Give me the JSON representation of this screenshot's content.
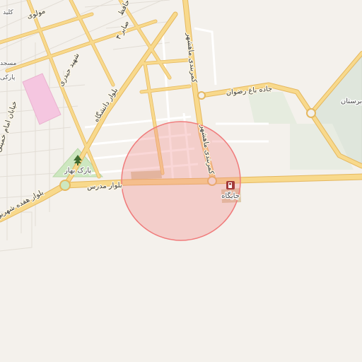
{
  "map": {
    "labels": {
      "road_east": "جاده باغ رضوان",
      "road_north_south": "کمربندی ماهشهر",
      "blvd_south": "بلوار مدرس",
      "blvd_northwest": "بلوار دانشگاه",
      "street_haftdah": "بلوار هفده شهریور",
      "street_heydari": "شهید حیدری",
      "street_imam": "خیابان امام خمینی",
      "street_molavi": "مولوی",
      "street_sabr": "صابر ۳",
      "street_top": "کلید",
      "street_hafez": "حافظ",
      "park": "پارک بهار",
      "gas_station": "جایگاه",
      "cemetery": "برستان",
      "mosque": "مسجد",
      "parking": "پارکی"
    },
    "colors": {
      "background": "#f4f1ec",
      "major_road": "#f8d98c",
      "major_road_casing": "#e5b85f",
      "minor_road": "#ffffff",
      "park": "#cde7c0",
      "hospital": "#f5c6e0",
      "cemetery": "#dfe6dc",
      "radius_circle": "#f28b8b"
    },
    "icons": [
      "tree-icon",
      "fuel-icon"
    ]
  }
}
